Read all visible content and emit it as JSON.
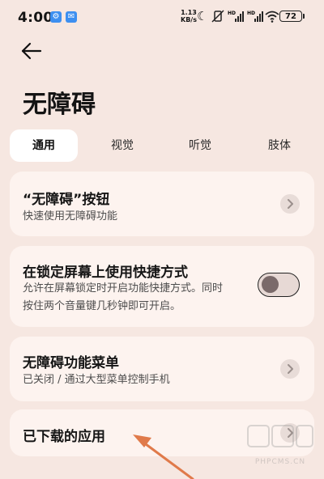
{
  "status_bar": {
    "time": "4:00",
    "net_speed_value": "1.13",
    "net_speed_unit": "KB/s",
    "battery": "72",
    "icons": [
      "settings-app-icon",
      "mail-app-icon",
      "moon-icon",
      "vibrate-off-icon",
      "hd-signal-icon",
      "hd-signal-icon",
      "wifi-icon",
      "battery-icon"
    ]
  },
  "header": {
    "title": "无障碍"
  },
  "tabs": [
    {
      "label": "通用",
      "active": true
    },
    {
      "label": "视觉",
      "active": false
    },
    {
      "label": "听觉",
      "active": false
    },
    {
      "label": "肢体",
      "active": false
    }
  ],
  "items": [
    {
      "title": "“无障碍”按钮",
      "subtitle": "快速使用无障碍功能",
      "control": "chevron"
    },
    {
      "title": "在锁定屏幕上使用快捷方式",
      "subtitle_line1": "允许在屏幕锁定时开启功能快捷方式。同时",
      "subtitle_line2": "按住两个音量键几秒钟即可开启。",
      "control": "toggle",
      "toggle_on": false
    },
    {
      "title": "无障碍功能菜单",
      "subtitle": "已关闭 / 通过大型菜单控制手机",
      "control": "chevron"
    },
    {
      "title": "已下载的应用",
      "control": "chevron"
    }
  ],
  "colors": {
    "background": "#f6e7e1",
    "card": "#fdf3ef",
    "active_tab": "#ffffff",
    "annotation_arrow": "#e07a4a"
  },
  "watermark": {
    "text": "PHPCMS.CN"
  }
}
